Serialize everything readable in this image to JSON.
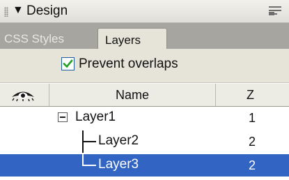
{
  "panel": {
    "title": "Design",
    "collapse_glyph": "▼",
    "options_icon": "panel-options-menu-icon"
  },
  "tabs": [
    {
      "label": "CSS Styles",
      "active": false
    },
    {
      "label": "Layers",
      "active": true
    }
  ],
  "options": {
    "prevent_overlaps_label": "Prevent overlaps",
    "prevent_overlaps_checked": true
  },
  "columns": {
    "visibility_icon": "eye-icon",
    "name": "Name",
    "z": "Z"
  },
  "layers": [
    {
      "name": "Layer1",
      "z": "1",
      "depth": 0,
      "expanded": true,
      "selected": false
    },
    {
      "name": "Layer2",
      "z": "2",
      "depth": 1,
      "selected": false
    },
    {
      "name": "Layer3",
      "z": "2",
      "depth": 1,
      "selected": true
    }
  ],
  "colors": {
    "selection": "#3264c4",
    "tab_active": "#e6e4d8",
    "tab_strip": "#a6a59f",
    "checkbox_border": "#1e5d9a",
    "checkmark": "#21a121"
  }
}
